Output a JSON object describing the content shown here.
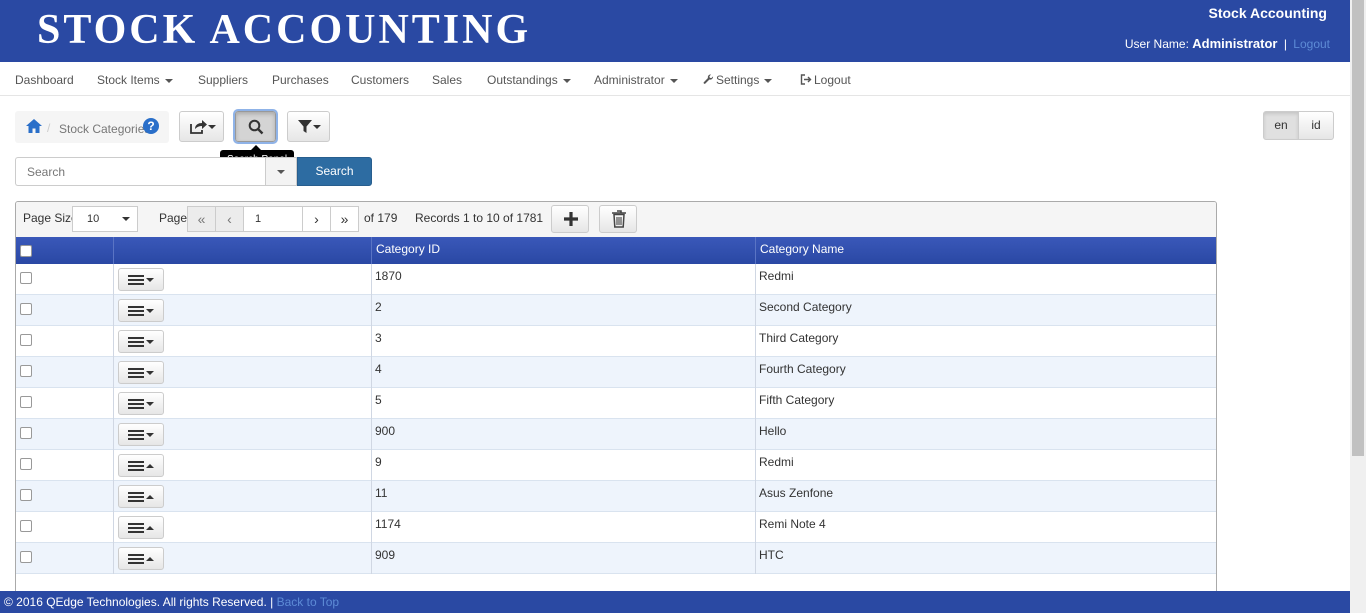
{
  "header": {
    "brand": "STOCK ACCOUNTING",
    "app_title": "Stock Accounting",
    "user_label": "User Name:",
    "user_name": "Administrator",
    "separator": "|",
    "logout": "Logout"
  },
  "nav": {
    "items": [
      {
        "label": "Dashboard"
      },
      {
        "label": "Stock Items"
      },
      {
        "label": "Suppliers"
      },
      {
        "label": "Purchases"
      },
      {
        "label": "Customers"
      },
      {
        "label": "Sales"
      },
      {
        "label": "Outstandings"
      },
      {
        "label": "Administrator"
      },
      {
        "label": "Settings"
      },
      {
        "label": "Logout"
      }
    ]
  },
  "breadcrumb": {
    "separator": "/",
    "current": "Stock Categories",
    "help": "?"
  },
  "toolbar": {
    "tooltip": "Search Panel"
  },
  "languages": [
    "en",
    "id"
  ],
  "search": {
    "placeholder": "Search",
    "button": "Search"
  },
  "pager": {
    "page_size_label": "Page Size",
    "page_size": "10",
    "page_label": "Page",
    "first": "«",
    "prev": "‹",
    "current_page": "1",
    "next": "›",
    "last": "»",
    "of_pages": "of 179",
    "records": "Records 1 to 10 of 1781"
  },
  "table": {
    "columns": [
      "Category ID",
      "Category Name"
    ],
    "rows": [
      {
        "id": "1870",
        "name": "Redmi",
        "menu_icon": "caret-down"
      },
      {
        "id": "2",
        "name": "Second Category",
        "menu_icon": "caret-down"
      },
      {
        "id": "3",
        "name": "Third Category",
        "menu_icon": "caret-down"
      },
      {
        "id": "4",
        "name": "Fourth Category",
        "menu_icon": "caret-down"
      },
      {
        "id": "5",
        "name": "Fifth Category",
        "menu_icon": "caret-down"
      },
      {
        "id": "900",
        "name": "Hello",
        "menu_icon": "caret-down"
      },
      {
        "id": "9",
        "name": "Redmi",
        "menu_icon": "caret-up"
      },
      {
        "id": "11",
        "name": "Asus Zenfone",
        "menu_icon": "caret-up"
      },
      {
        "id": "1174",
        "name": "Remi Note 4",
        "menu_icon": "caret-up"
      },
      {
        "id": "909",
        "name": "HTC",
        "menu_icon": "caret-up"
      }
    ]
  },
  "footer": {
    "copyright": "© 2016 QEdge Technologies. All rights Reserved.",
    "separator": "|",
    "back_to_top": "Back to Top"
  },
  "colors": {
    "brand_blue": "#2a49a3",
    "header_row": "#2a48a4",
    "search_button": "#2d6ca2",
    "link": "#5d8bd6"
  }
}
